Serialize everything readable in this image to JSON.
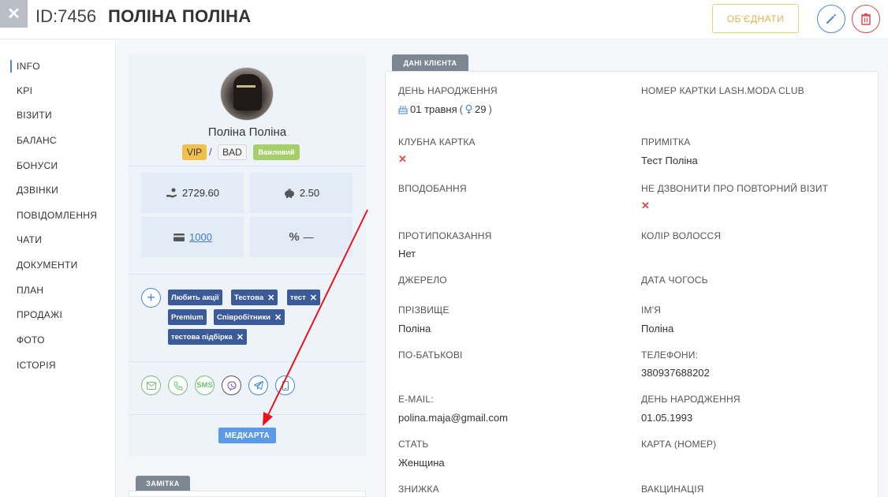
{
  "header": {
    "close_glyph": "✕",
    "client_id": "ID:7456",
    "client_name": "ПОЛІНА ПОЛІНА",
    "merge_label": "ОБ'ЄДНАТИ"
  },
  "sidebar": {
    "items": [
      {
        "label": "INFO",
        "active": true
      },
      {
        "label": "KPI"
      },
      {
        "label": "ВІЗИТИ"
      },
      {
        "label": "БАЛАНС"
      },
      {
        "label": "БОНУСИ"
      },
      {
        "label": "ДЗВІНКИ"
      },
      {
        "label": "ПОВІДОМЛЕННЯ"
      },
      {
        "label": "ЧАТИ"
      },
      {
        "label": "ДОКУМЕНТИ"
      },
      {
        "label": "ПЛАН"
      },
      {
        "label": "ПРОДАЖІ"
      },
      {
        "label": "ФОТО"
      },
      {
        "label": "ІСТОРІЯ"
      }
    ]
  },
  "profile": {
    "name": "Поліна Поліна",
    "badges": {
      "vip": "VIP",
      "separator": "/",
      "bad": "BAD",
      "important": "Важливий"
    },
    "stats": {
      "balance": "2729.60",
      "bonus": "2.50",
      "card": "1000",
      "discount": "—"
    },
    "tags": [
      {
        "label": "Любить акції",
        "removable": false
      },
      {
        "label": "Тестова",
        "removable": true
      },
      {
        "label": "тест",
        "removable": true
      },
      {
        "label": "Premium",
        "removable": false
      },
      {
        "label": "Співробітники",
        "removable": true
      },
      {
        "label": "тестова підбірка",
        "removable": true
      }
    ],
    "sms_label": "SMS",
    "medcard_label": "МЕДКАРТА",
    "note_tab_label": "ЗАМІТКА"
  },
  "client_data": {
    "tab_label": "ДАНІ КЛІЄНТА",
    "birthday_label": "ДЕНЬ НАРОДЖЕННЯ",
    "birthday_value": "01 травня",
    "age_value": "29",
    "club_card_no_label": "НОМЕР КАРТКИ LASH.MODA CLUB",
    "club_card_label": "КЛУБНА КАРТКА",
    "note_label": "ПРИМІТКА",
    "note_value": "Тест Поліна",
    "preferences_label": "ВПОДОБАННЯ",
    "no_call_label": "НЕ ДЗВОНИТИ ПРО ПОВТОРНИЙ ВІЗИТ",
    "contraindications_label": "ПРОТИПОКАЗАННЯ",
    "contraindications_value": "Нет",
    "hair_color_label": "КОЛІР ВОЛОССЯ",
    "source_label": "ДЖЕРЕЛО",
    "some_date_label": "ДАТА ЧОГОСЬ",
    "surname_label": "ПРІЗВИЩЕ",
    "surname_value": "Поліна",
    "firstname_label": "ІМ'Я",
    "firstname_value": "Поліна",
    "patronymic_label": "ПО-БАТЬКОВІ",
    "phones_label": "ТЕЛЕФОНИ:",
    "phones_value": "380937688202",
    "email_label": "E-MAIL:",
    "email_value": "polina.maja@gmail.com",
    "birthdate_label": "ДЕНЬ НАРОДЖЕННЯ",
    "birthdate_value": "01.05.1993",
    "gender_label": "СТАТЬ",
    "gender_value": "Женщина",
    "card_number_label": "КАРТА (НОМЕР)",
    "discount_label": "ЗНИЖКА",
    "vaccination_label": "ВАКЦИНАЦІЯ",
    "x_mark": "✕"
  },
  "colors": {
    "accent": "#4a86e0",
    "merge": "#e0b449",
    "delete": "#e04a4a",
    "tag_bg": "#3a5a9a",
    "vip": "#f0c04a",
    "important": "#a6cf6b",
    "annotation_arrow": "#e8141b"
  },
  "icons": [
    "close-icon",
    "pencil-icon",
    "trash-icon",
    "hand-coins-icon",
    "piggy-bank-icon",
    "credit-card-icon",
    "percent-icon",
    "plus-icon",
    "remove-icon",
    "email-icon",
    "phone-icon",
    "sms-icon",
    "viber-icon",
    "telegram-icon",
    "mobile-icon",
    "cake-icon",
    "gender-icon"
  ]
}
